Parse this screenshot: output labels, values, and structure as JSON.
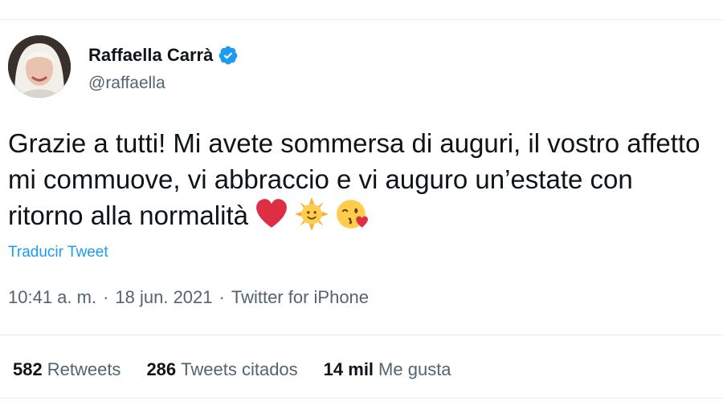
{
  "author": {
    "name": "Raffaella Carrà",
    "handle": "@raffaella",
    "verified": true
  },
  "tweet": {
    "text": "Grazie a tutti! Mi avete sommersa di auguri, il vostro affetto mi commuove, vi abbraccio e vi auguro un’estate con ritorno alla normalità",
    "emojis": [
      "red-heart-icon",
      "sun-with-face-icon",
      "face-blowing-kiss-icon"
    ]
  },
  "translate_label": "Traducir Tweet",
  "meta": {
    "time": "10:41 a. m.",
    "separator": "·",
    "date": "18 jun. 2021",
    "source": "Twitter for iPhone"
  },
  "stats": {
    "retweets_count": "582",
    "retweets_label": "Retweets",
    "quotes_count": "286",
    "quotes_label": "Tweets citados",
    "likes_count": "14 mil",
    "likes_label": "Me gusta"
  },
  "colors": {
    "link": "#1d9bf0",
    "secondary_text": "#536471",
    "primary_text": "#0f1419",
    "divider": "#e6ecf0"
  }
}
